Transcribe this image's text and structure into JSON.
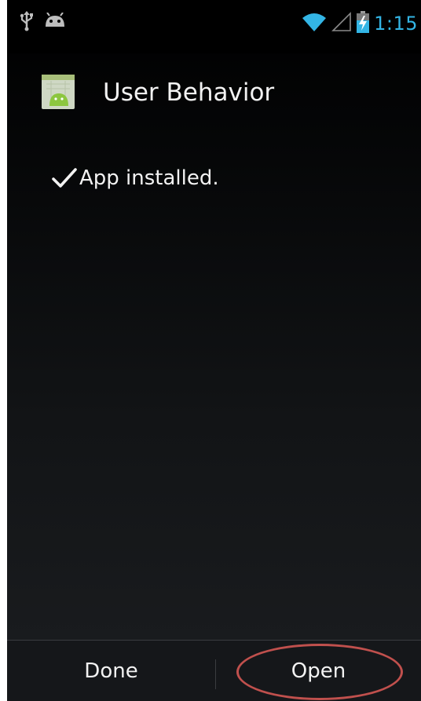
{
  "status_bar": {
    "time": "1:15",
    "left_icons": [
      "usb-icon",
      "android-debug-icon"
    ],
    "right_icons": [
      "wifi-icon",
      "signal-icon",
      "battery-icon"
    ],
    "accent_color": "#33b5e5"
  },
  "dialog": {
    "app_name": "User Behavior",
    "app_icon": "android-app-icon",
    "status_message": "App installed.",
    "status_icon": "checkmark-icon"
  },
  "actions": {
    "done_label": "Done",
    "open_label": "Open",
    "highlight_color": "#c0504d"
  }
}
